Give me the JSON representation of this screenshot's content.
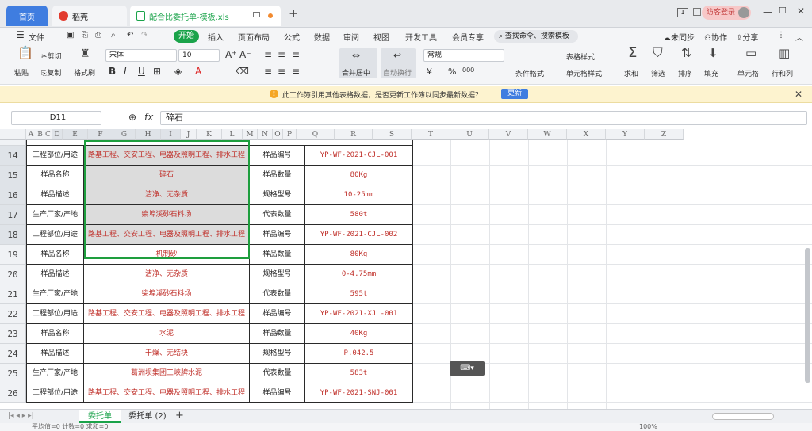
{
  "tabs": {
    "home": "首页",
    "wps": "稻壳",
    "file": "配合比委托单-模板.xls",
    "new": "+"
  },
  "window": {
    "page_num": "1",
    "login": "访客登录"
  },
  "menu": {
    "file": "文件",
    "start": "开始",
    "items": [
      "插入",
      "页面布局",
      "公式",
      "数据",
      "审阅",
      "视图",
      "开发工具",
      "会员专享"
    ],
    "search": "查找命令、搜索模板",
    "sync": "未同步",
    "collab": "协作",
    "share": "分享"
  },
  "ribbon": {
    "paste": "粘贴",
    "cut": "剪切",
    "copy": "复制",
    "format_painter": "格式刷",
    "font": "宋体",
    "size": "10",
    "merge": "合并居中",
    "wrap": "自动换行",
    "number_format": "常规",
    "cond_format": "条件格式",
    "table_style": "表格样式",
    "cell_style": "单元格样式",
    "sum": "求和",
    "filter": "筛选",
    "sort": "排序",
    "fill": "填充",
    "cell": "单元格",
    "rowcol": "行和列",
    "currency": "¥",
    "percent": "%",
    "thousands": "000"
  },
  "notice": {
    "text": "此工作簿引用其他表格数据，是否更新工作簿以同步最新数据？",
    "button": "更新"
  },
  "formula": {
    "cell_ref": "D11",
    "fx": "fx",
    "value": "碎石"
  },
  "columns": [
    "A",
    "B",
    "C",
    "D",
    "E",
    "F",
    "G",
    "H",
    "I",
    "J",
    "K",
    "L",
    "M",
    "N",
    "O",
    "P",
    "Q",
    "R",
    "S",
    "T",
    "U",
    "V",
    "W",
    "X",
    "Y",
    "Z"
  ],
  "rows": [
    {
      "num": "14",
      "c1": "工程部位/用途",
      "c2": "路基工程、交安工程、电器及照明工程、排水工程",
      "c3": "样品编号",
      "c4": "YP-WF-2021-CJL-001"
    },
    {
      "num": "15",
      "c1": "样品名称",
      "c2": "碎石",
      "c3": "样品数量",
      "c4": "80Kg"
    },
    {
      "num": "16",
      "c1": "样品描述",
      "c2": "洁净、无杂质",
      "c3": "规格型号",
      "c4": "10-25mm"
    },
    {
      "num": "17",
      "c1": "生产厂家/产地",
      "c2": "柴埠溪砂石料场",
      "c3": "代表数量",
      "c4": "580t"
    },
    {
      "num": "18",
      "c1": "工程部位/用途",
      "c2": "路基工程、交安工程、电器及照明工程、排水工程",
      "c3": "样品编号",
      "c4": "YP-WF-2021-CJL-002"
    },
    {
      "num": "19",
      "c1": "样品名称",
      "c2": "机制砂",
      "c3": "样品数量",
      "c4": "80Kg"
    },
    {
      "num": "20",
      "c1": "样品描述",
      "c2": "洁净、无杂质",
      "c3": "规格型号",
      "c4": "0-4.75mm"
    },
    {
      "num": "21",
      "c1": "生产厂家/产地",
      "c2": "柴埠溪砂石料场",
      "c3": "代表数量",
      "c4": "595t"
    },
    {
      "num": "22",
      "c1": "工程部位/用途",
      "c2": "路基工程、交安工程、电器及照明工程、排水工程",
      "c3": "样品编号",
      "c4": "YP-WF-2021-XJL-001"
    },
    {
      "num": "23",
      "c1": "样品名称",
      "c2": "水泥",
      "c3": "样品数量",
      "c4": "40Kg"
    },
    {
      "num": "24",
      "c1": "样品描述",
      "c2": "干燥、无结块",
      "c3": "规格型号",
      "c4": "P.042.5"
    },
    {
      "num": "25",
      "c1": "生产厂家/产地",
      "c2": "葛洲坝集团三峡牌水泥",
      "c3": "代表数量",
      "c4": "583t"
    },
    {
      "num": "26",
      "c1": "工程部位/用途",
      "c2": "路基工程、交安工程、电器及照明工程、排水工程",
      "c3": "样品编号",
      "c4": "YP-WF-2021-SNJ-001"
    }
  ],
  "sheets": [
    "委托单",
    "委托单 (2)"
  ],
  "status": {
    "text": "平均值=0  计数=0  求和=0",
    "zoom": "100%"
  },
  "colors": {
    "accent": "#1aa34a",
    "selection": "#1e9e3e",
    "red_text": "#c0312b"
  }
}
